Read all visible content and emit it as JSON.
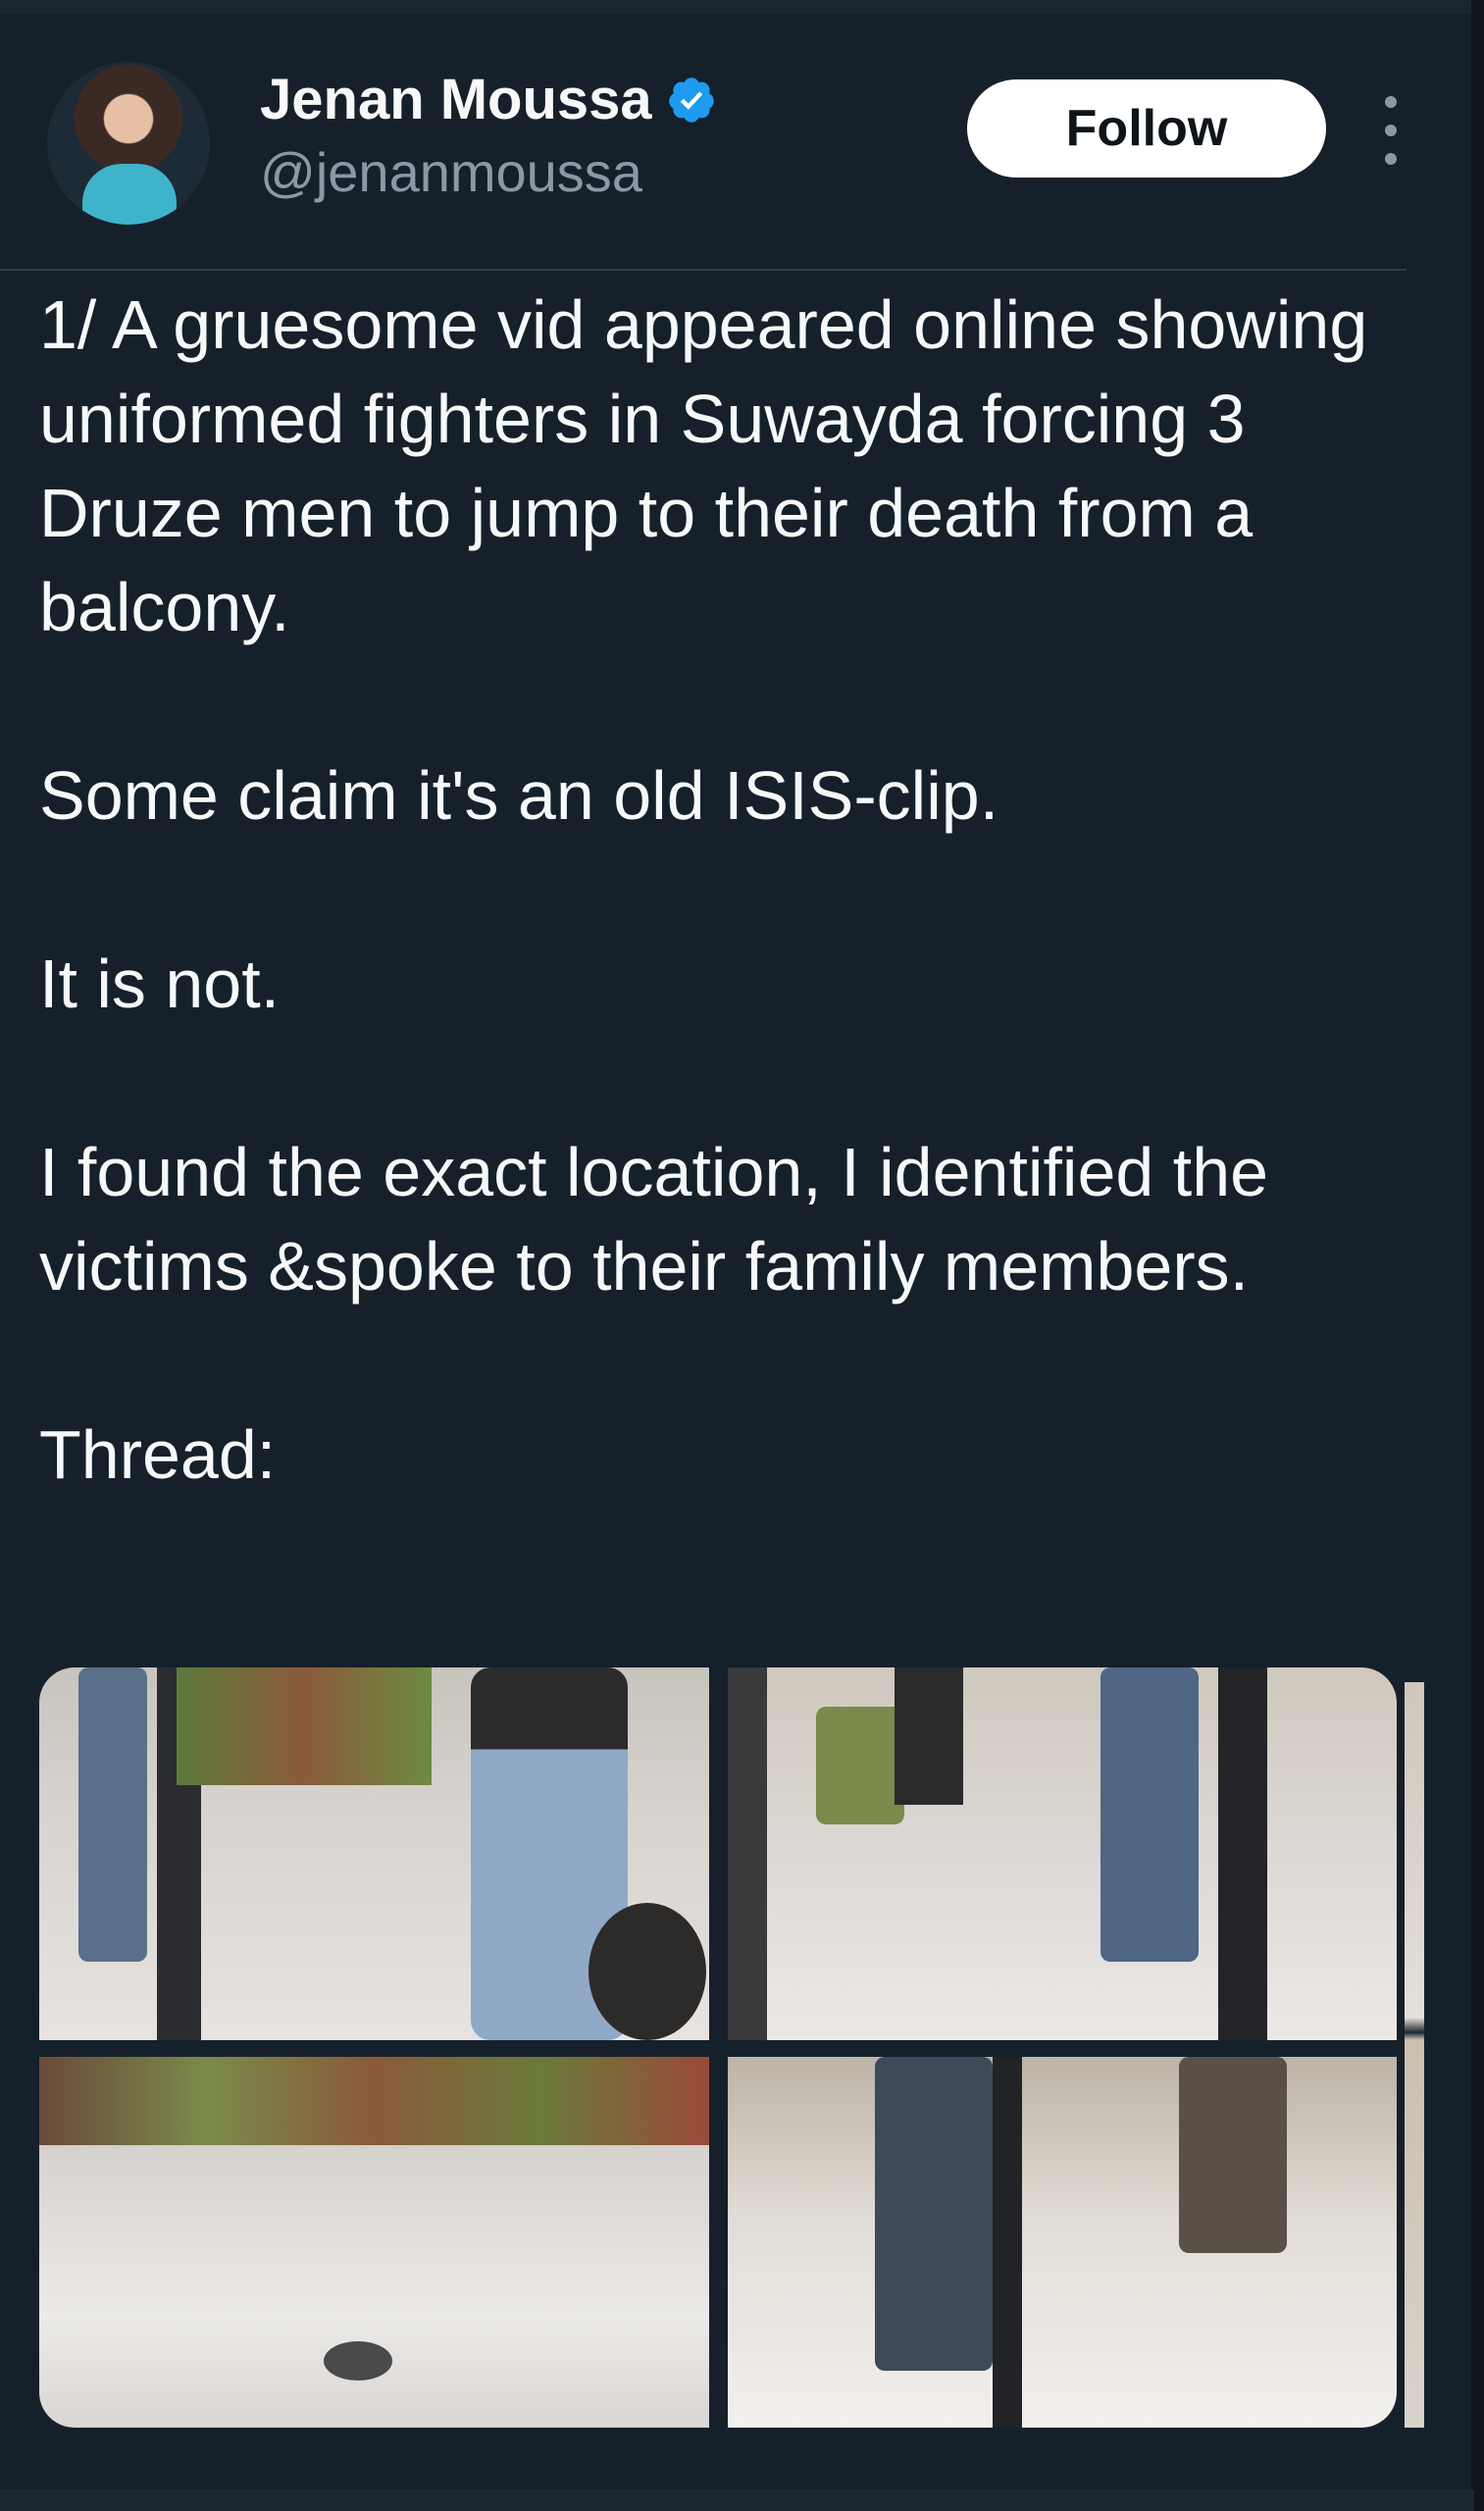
{
  "tweet": {
    "author": {
      "display_name": "Jenan Moussa",
      "handle": "@jenanmoussa",
      "verified": true
    },
    "follow_label": "Follow",
    "paragraphs": [
      "1/ A gruesome vid appeared online showing uniformed fighters in Suwayda forcing 3 Druze men to jump to their death from a balcony.",
      "Some claim it's an old ISIS-clip.",
      "It is not.",
      "I found the exact location, I identified the victims &spoke to their family members.",
      "Thread:"
    ],
    "media_count": 4
  },
  "icons": {
    "verified": "verified-badge-icon",
    "more": "more-options-icon"
  },
  "colors": {
    "background": "#15202b",
    "text": "#f7f9f9",
    "secondary_text": "#8b98a5",
    "verified_blue": "#1d9bf0",
    "follow_button_bg": "#ffffff"
  }
}
